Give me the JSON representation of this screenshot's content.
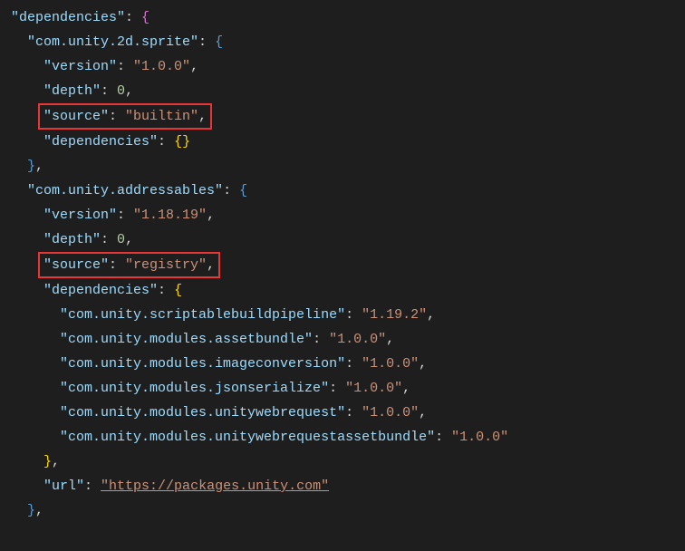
{
  "root": {
    "dependencies_key": "\"dependencies\"",
    "pkg1_key": "\"com.unity.2d.sprite\"",
    "pkg2_key": "\"com.unity.addressables\"",
    "version_key": "\"version\"",
    "depth_key": "\"depth\"",
    "source_key": "\"source\"",
    "deps_key": "\"dependencies\"",
    "url_key": "\"url\""
  },
  "pkg1": {
    "version": "\"1.0.0\"",
    "depth": "0",
    "source": "\"builtin\""
  },
  "pkg2": {
    "version": "\"1.18.19\"",
    "depth": "0",
    "source": "\"registry\"",
    "url": "\"https://packages.unity.com\"",
    "deps": {
      "k1": "\"com.unity.scriptablebuildpipeline\"",
      "v1": "\"1.19.2\"",
      "k2": "\"com.unity.modules.assetbundle\"",
      "v2": "\"1.0.0\"",
      "k3": "\"com.unity.modules.imageconversion\"",
      "v3": "\"1.0.0\"",
      "k4": "\"com.unity.modules.jsonserialize\"",
      "v4": "\"1.0.0\"",
      "k5": "\"com.unity.modules.unitywebrequest\"",
      "v5": "\"1.0.0\"",
      "k6": "\"com.unity.modules.unitywebrequestassetbundle\"",
      "v6": "\"1.0.0\""
    }
  }
}
